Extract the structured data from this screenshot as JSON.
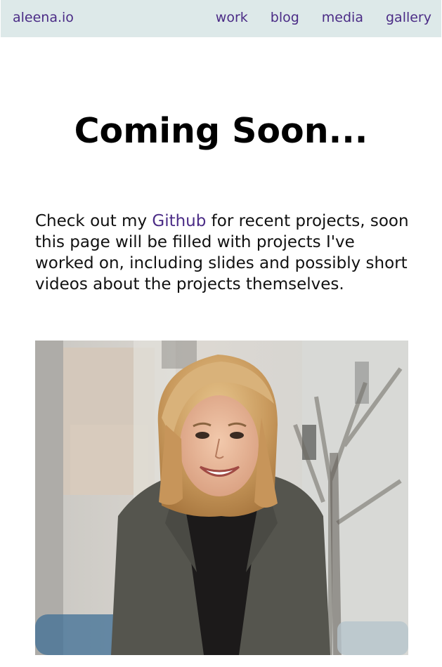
{
  "nav": {
    "brand": "aleena.io",
    "links": [
      "work",
      "blog",
      "media",
      "gallery"
    ]
  },
  "main": {
    "title": "Coming Soon...",
    "intro_before": "Check out my ",
    "github_link": "Github",
    "intro_after": " for recent projects, soon this page will be filled with projects I've worked on, including slides and possibly short videos about the projects themselves."
  },
  "colors": {
    "nav_background": "#dde9e9",
    "link": "#4b2c86",
    "text": "#111111"
  },
  "photo": {
    "icon": "portrait-photo"
  }
}
